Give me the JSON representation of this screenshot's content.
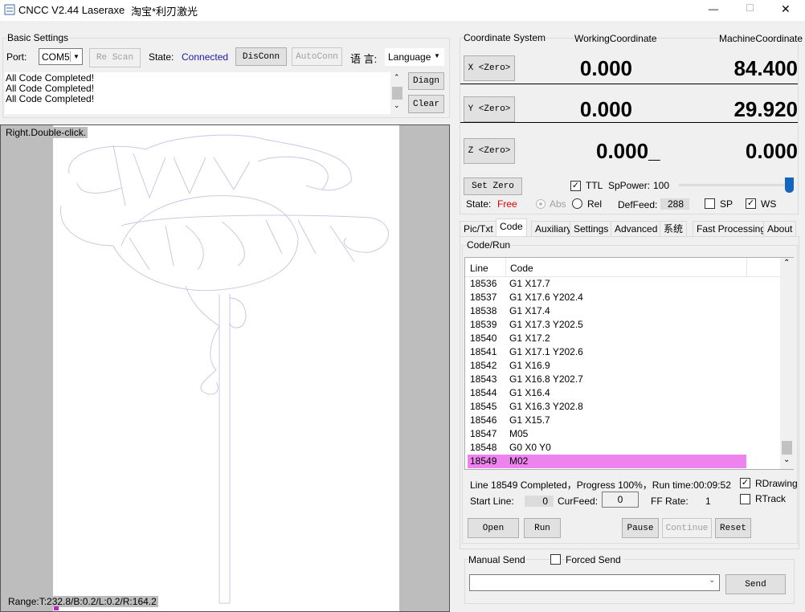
{
  "window": {
    "title": "CNCC V2.44  Laseraxe",
    "subtitle": "淘宝*利刃激光",
    "minimize": "—",
    "maximize": "☐",
    "close": "✕"
  },
  "basic": {
    "title": "Basic Settings",
    "port_label": "Port:",
    "port_value": "COM5",
    "rescan": "Re Scan",
    "state_label": "State:",
    "state_value": "Connected",
    "disconn": "DisConn",
    "autoconn": "AutoConn",
    "lang_label": "语 言:",
    "lang_value": "Language",
    "log": [
      "All Code Completed!",
      "All Code Completed!",
      "All Code Completed!"
    ],
    "diagn": "Diagn",
    "clear": "Clear"
  },
  "canvas": {
    "hint": "Right.Double-click.",
    "range": "Range:T:232.8/B:0.2/L:0.2/R:164.2"
  },
  "coords": {
    "title": "Coordinate System",
    "working": "WorkingCoordinate",
    "machine": "MachineCoordinate",
    "axes": [
      {
        "btn": "X <Zero>",
        "work": "0.000",
        "mach": "84.400"
      },
      {
        "btn": "Y <Zero>",
        "work": "0.000",
        "mach": "29.920"
      },
      {
        "btn": "Z <Zero>",
        "work": "0.000_",
        "mach": "0.000"
      }
    ],
    "set_zero": "Set Zero",
    "ttl": "TTL",
    "ttl_checked": true,
    "sppower_label": "SpPower:",
    "sppower": "100",
    "sppower_fraction": 1.0,
    "state_label": "State:",
    "state_value": "Free",
    "abs": "Abs",
    "rel": "Rel",
    "deffeed_label": "DefFeed:",
    "deffeed": "288",
    "sp": "SP",
    "sp_checked": false,
    "ws": "WS",
    "ws_checked": true
  },
  "tabs": [
    "Pic/Txt",
    "Code",
    "Auxiliary",
    "Settings",
    "Advanced",
    "系统",
    "Fast Processing",
    "About"
  ],
  "code": {
    "title": "Code/Run",
    "col_line": "Line",
    "col_code": "Code",
    "rows": [
      [
        "18536",
        "G1 X17.7"
      ],
      [
        "18537",
        "G1 X17.6 Y202.4"
      ],
      [
        "18538",
        "G1 X17.4"
      ],
      [
        "18539",
        "G1 X17.3 Y202.5"
      ],
      [
        "18540",
        "G1 X17.2"
      ],
      [
        "18541",
        "G1 X17.1 Y202.6"
      ],
      [
        "18542",
        "G1 X16.9"
      ],
      [
        "18543",
        "G1 X16.8 Y202.7"
      ],
      [
        "18544",
        "G1 X16.4"
      ],
      [
        "18545",
        "G1 X16.3 Y202.8"
      ],
      [
        "18546",
        "G1 X15.7"
      ],
      [
        "18547",
        "M05"
      ],
      [
        "18548",
        "G0 X0 Y0"
      ],
      [
        "18549",
        "M02"
      ]
    ],
    "status": "Line 18549 Completed，Progress 100%，Run time:00:09:52",
    "rdrawing": "RDrawing",
    "rtrack": "RTrack",
    "start_line_label": "Start Line:",
    "start_line": "0",
    "curfeed_label": "CurFeed:",
    "curfeed": "0",
    "ffrate_label": "FF Rate:",
    "ffrate": "1",
    "open": "Open",
    "run": "Run",
    "pause": "Pause",
    "continue": "Continue",
    "reset": "Reset"
  },
  "manual": {
    "title": "Manual Send",
    "forced": "Forced Send",
    "input": "",
    "send": "Send"
  },
  "colors": {
    "highlight": "#ee82ee",
    "connected": "#1a1aa6",
    "free": "#e00000",
    "slider": "#1565c0"
  }
}
